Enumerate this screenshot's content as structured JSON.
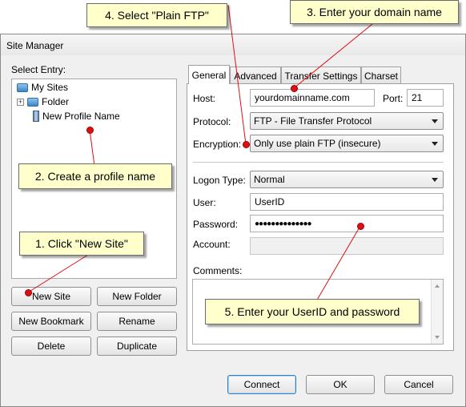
{
  "window": {
    "title": "Site Manager"
  },
  "left": {
    "select_entry_label": "Select Entry:",
    "tree": [
      {
        "label": "My Sites"
      },
      {
        "label": "Folder"
      },
      {
        "label": "New Profile Name"
      }
    ],
    "buttons": {
      "new_site": "New Site",
      "new_folder": "New Folder",
      "new_bookmark": "New Bookmark",
      "rename": "Rename",
      "delete": "Delete",
      "duplicate": "Duplicate"
    }
  },
  "tabs": [
    "General",
    "Advanced",
    "Transfer Settings",
    "Charset"
  ],
  "general": {
    "host_label": "Host:",
    "host_value": "yourdomainname.com",
    "port_label": "Port:",
    "port_value": "21",
    "protocol_label": "Protocol:",
    "protocol_value": "FTP - File Transfer Protocol",
    "encryption_label": "Encryption:",
    "encryption_value": "Only use plain FTP (insecure)",
    "logon_type_label": "Logon Type:",
    "logon_type_value": "Normal",
    "user_label": "User:",
    "user_value": "UserID",
    "password_label": "Password:",
    "password_value": "●●●●●●●●●●●●●●",
    "account_label": "Account:",
    "account_value": "",
    "comments_label": "Comments:",
    "comments_value": ""
  },
  "footer": {
    "connect": "Connect",
    "ok": "OK",
    "cancel": "Cancel"
  },
  "annotations": {
    "step1": "1. Click \"New Site\"",
    "step2": "2. Create a profile name",
    "step3": "3. Enter your domain name",
    "step4": "4. Select \"Plain FTP\"",
    "step5": "5. Enter your UserID and password"
  },
  "colors": {
    "annotation_bg": "#ffffcc",
    "marker": "#e01010",
    "line": "#e01010"
  }
}
